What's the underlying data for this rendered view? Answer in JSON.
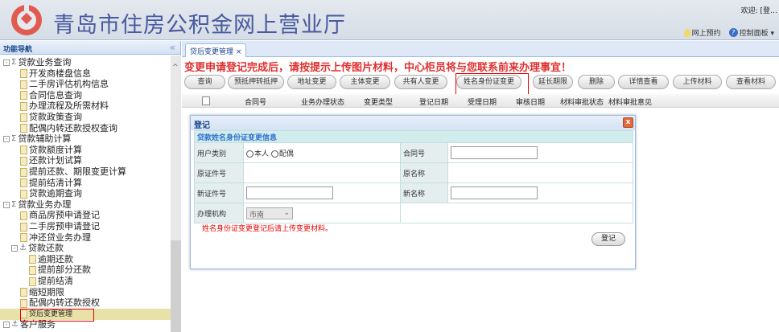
{
  "header": {
    "title": "青岛市住房公积金网上营业厅",
    "welcome": "欢迎: [登…",
    "links": [
      {
        "icon": "bulb-icon",
        "label": "网上预约"
      },
      {
        "icon": "help-icon",
        "label": "控制面板 ▾"
      }
    ]
  },
  "sidebar": {
    "title": "功能导航",
    "collapse": "«",
    "items": [
      {
        "label": "贷款业务查询",
        "level": 0,
        "type": "group"
      },
      {
        "label": "开发商楼盘信息",
        "level": 1
      },
      {
        "label": "二手房评估机构信息",
        "level": 1
      },
      {
        "label": "合同信息查询",
        "level": 1
      },
      {
        "label": "办理流程及所需材料",
        "level": 1
      },
      {
        "label": "贷款政策查询",
        "level": 1
      },
      {
        "label": "配偶内转还款授权查询",
        "level": 1
      },
      {
        "label": "贷款辅助计算",
        "level": 0,
        "type": "group"
      },
      {
        "label": "贷款额度计算",
        "level": 1
      },
      {
        "label": "还款计划试算",
        "level": 1
      },
      {
        "label": "提前还款、期限变更计算",
        "level": 1
      },
      {
        "label": "提前结清计算",
        "level": 1
      },
      {
        "label": "贷款逾期查询",
        "level": 1
      },
      {
        "label": "贷款业务办理",
        "level": 0,
        "type": "group"
      },
      {
        "label": "商品房预申请登记",
        "level": 1
      },
      {
        "label": "二手房预申请登记",
        "level": 1
      },
      {
        "label": "冲还贷业务办理",
        "level": 1
      },
      {
        "label": "贷款还款",
        "level": 1,
        "type": "subgroup"
      },
      {
        "label": "逾期还款",
        "level": 2
      },
      {
        "label": "提前部分还款",
        "level": 2
      },
      {
        "label": "提前结清",
        "level": 2
      },
      {
        "label": "缩短期限",
        "level": 1
      },
      {
        "label": "配偶内转还款授权",
        "level": 1
      },
      {
        "label": "贷后变更管理",
        "level": 1,
        "selected": true
      },
      {
        "label": "客户服务",
        "level": 0,
        "type": "subgroup"
      }
    ]
  },
  "main": {
    "tab": "贷后变更管理 ×",
    "notice": "变更申请登记完成后，请按提示上传图片材料，中心柜员将与您联系前来办理事宜！",
    "buttons": [
      "查询",
      "预抵押转抵押",
      "地址变更",
      "主体变更",
      "共有人变更",
      "姓名身份证变更",
      "延长期限",
      "删除",
      "详情查看",
      "上传材料",
      "查看材料"
    ],
    "columns": [
      "合同号",
      "业务办理状态",
      "变更类型",
      "登记日期",
      "受理日期",
      "审核日期",
      "材料审批状态",
      "材料审批意见"
    ]
  },
  "dialog": {
    "title": "登记",
    "close": "x",
    "section": "贷款姓名身份证变更信息",
    "user_type_label": "用户类别",
    "opt_self": "本人",
    "opt_spouse": "配偶",
    "contract_label": "合同号",
    "contract_value": "",
    "old_id_label": "原证件号",
    "old_name_label": "原名称",
    "new_id_label": "新证件号",
    "new_id_value": "",
    "new_name_label": "新名称",
    "new_name_value": "",
    "org_label": "办理机构",
    "org_value": "市南",
    "note": "姓名身份证变更登记后请上传变更材料。",
    "submit": "登记"
  }
}
